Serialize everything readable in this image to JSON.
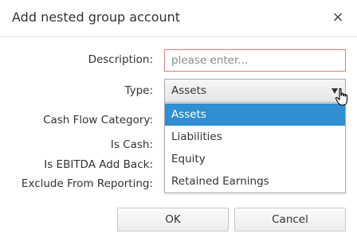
{
  "dialog": {
    "title": "Add nested group account",
    "close_glyph": "×"
  },
  "form": {
    "description_label": "Description:",
    "description_placeholder": "please enter...",
    "description_value": "",
    "type_label": "Type:",
    "type_selected": "Assets",
    "cash_flow_label": "Cash Flow Category:",
    "is_cash_label": "Is Cash:",
    "is_ebitda_label": "Is EBITDA Add Back:",
    "exclude_label": "Exclude From Reporting:"
  },
  "dropdown": {
    "options": [
      "Assets",
      "Liabilities",
      "Equity",
      "Retained Earnings"
    ],
    "highlighted": "Assets"
  },
  "buttons": {
    "ok": "OK",
    "cancel": "Cancel"
  },
  "colors": {
    "highlight": "#2f8fd0",
    "invalid_border": "#e07b7b"
  },
  "icons": {
    "close": "close-icon",
    "caret": "caret-down-icon",
    "cursor": "hand-pointer-icon"
  }
}
